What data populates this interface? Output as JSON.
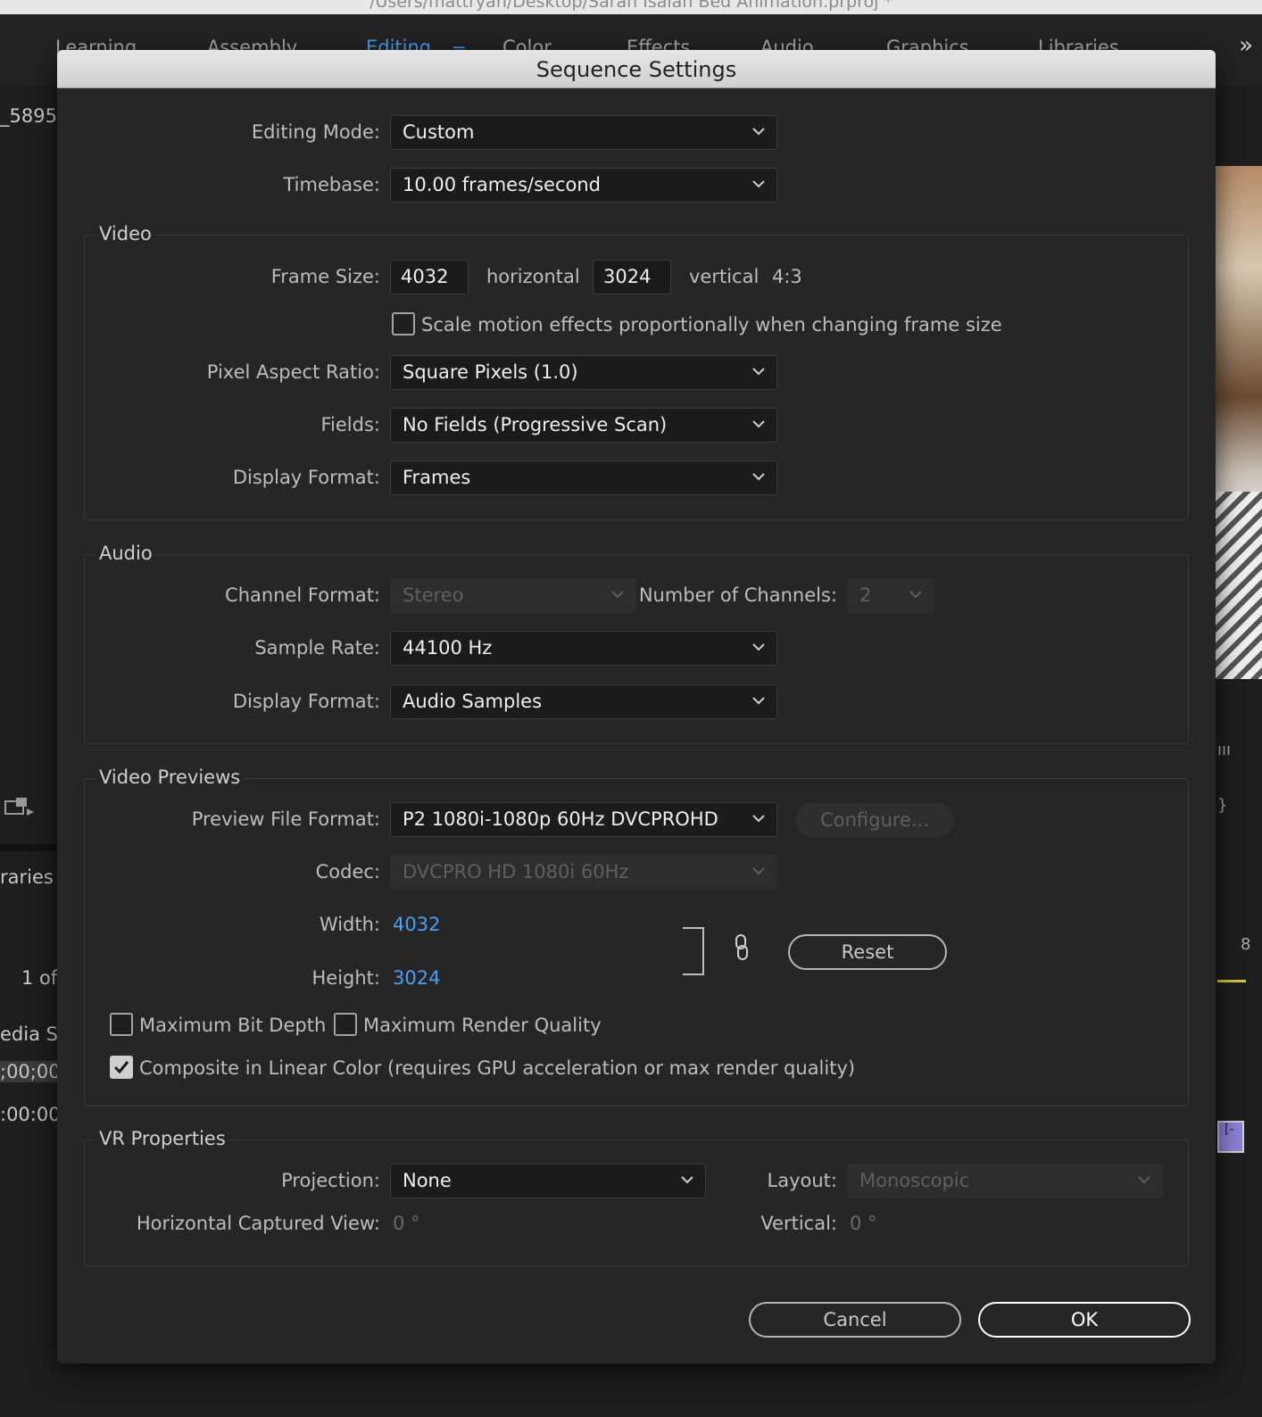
{
  "window": {
    "title": "/Users/mattryan/Desktop/Sarah Isaiah Bed Animation.prproj *"
  },
  "workspaces": {
    "tabs": [
      "Learning",
      "Assembly",
      "Editing",
      "Color",
      "Effects",
      "Audio",
      "Graphics",
      "Libraries"
    ],
    "active": "Editing",
    "menu_glyph": "≡",
    "more_glyph": "»"
  },
  "left_panel": {
    "clip_name": "_5895",
    "libraries_label": "raries",
    "page_indicator": "1 of",
    "media_start_label": "edia Sta",
    "timecode_1": ";00;00",
    "timecode_2": ":00:00"
  },
  "dialog": {
    "title": "Sequence Settings",
    "editing_mode": {
      "label": "Editing Mode:",
      "value": "Custom"
    },
    "timebase": {
      "label": "Timebase:",
      "value": "10.00  frames/second"
    },
    "video": {
      "group_title": "Video",
      "frame_size_label": "Frame Size:",
      "width": "4032",
      "horizontal_label": "horizontal",
      "height": "3024",
      "vertical_label": "vertical",
      "aspect": "4:3",
      "scale_motion_label": "Scale motion effects proportionally when changing frame size",
      "scale_motion_checked": false,
      "pixel_aspect": {
        "label": "Pixel Aspect Ratio:",
        "value": "Square Pixels (1.0)"
      },
      "fields": {
        "label": "Fields:",
        "value": "No Fields (Progressive Scan)"
      },
      "display_format": {
        "label": "Display Format:",
        "value": "Frames"
      }
    },
    "audio": {
      "group_title": "Audio",
      "channel_format": {
        "label": "Channel Format:",
        "value": "Stereo"
      },
      "num_channels": {
        "label": "Number of Channels:",
        "value": "2"
      },
      "sample_rate": {
        "label": "Sample Rate:",
        "value": "44100 Hz"
      },
      "display_format": {
        "label": "Display Format:",
        "value": "Audio Samples"
      }
    },
    "previews": {
      "group_title": "Video Previews",
      "preview_format": {
        "label": "Preview File Format:",
        "value": "P2 1080i-1080p 60Hz DVCPROHD"
      },
      "configure_label": "Configure...",
      "codec": {
        "label": "Codec:",
        "value": "DVCPRO HD 1080i 60Hz"
      },
      "width": {
        "label": "Width:",
        "value": "4032"
      },
      "height": {
        "label": "Height:",
        "value": "3024"
      },
      "reset_label": "Reset",
      "max_bit_depth": {
        "label": "Maximum Bit Depth",
        "checked": false
      },
      "max_render_quality": {
        "label": "Maximum Render Quality",
        "checked": false
      },
      "composite_linear": {
        "label": "Composite in Linear Color (requires GPU acceleration or max render quality)",
        "checked": true
      }
    },
    "vr": {
      "group_title": "VR Properties",
      "projection": {
        "label": "Projection:",
        "value": "None"
      },
      "layout": {
        "label": "Layout:",
        "value": "Monoscopic"
      },
      "h_captured_view": {
        "label": "Horizontal Captured View:",
        "value": "0 °"
      },
      "vertical": {
        "label": "Vertical:",
        "value": "0 °"
      }
    },
    "buttons": {
      "cancel": "Cancel",
      "ok": "OK"
    }
  },
  "colors": {
    "accent_blue": "#4a9ef5",
    "dialog_bg": "#262626",
    "field_bg": "#1b1b1b"
  }
}
